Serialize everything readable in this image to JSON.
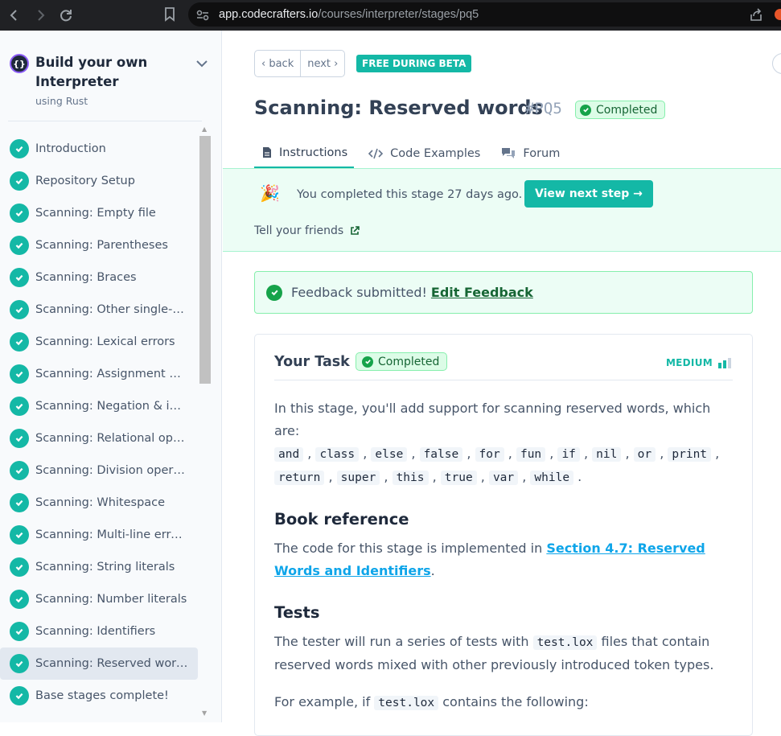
{
  "browser": {
    "url_host": "app.codecrafters.io",
    "url_path": "/courses/interpreter/stages/pq5"
  },
  "sidebar": {
    "course_title": "Build your own Interpreter",
    "course_subtitle": "using Rust",
    "stages": [
      {
        "label": "Introduction"
      },
      {
        "label": "Repository Setup"
      },
      {
        "label": "Scanning: Empty file"
      },
      {
        "label": "Scanning: Parentheses"
      },
      {
        "label": "Scanning: Braces"
      },
      {
        "label": "Scanning: Other single-c..."
      },
      {
        "label": "Scanning: Lexical errors"
      },
      {
        "label": "Scanning: Assignment & ..."
      },
      {
        "label": "Scanning: Negation & ine..."
      },
      {
        "label": "Scanning: Relational oper..."
      },
      {
        "label": "Scanning: Division operat..."
      },
      {
        "label": "Scanning: Whitespace"
      },
      {
        "label": "Scanning: Multi-line errors"
      },
      {
        "label": "Scanning: String literals"
      },
      {
        "label": "Scanning: Number literals"
      },
      {
        "label": "Scanning: Identifiers"
      },
      {
        "label": "Scanning: Reserved words"
      },
      {
        "label": "Base stages complete!"
      }
    ],
    "active_stage": "Scanning: Reserved words"
  },
  "header": {
    "back_label": "‹ back",
    "next_label": "next ›",
    "beta_badge": "FREE DURING BETA",
    "stage_title": "Scanning: Reserved words",
    "stage_slug": "#PQ5",
    "status": "Completed"
  },
  "tabs": [
    {
      "label": "Instructions",
      "active": true
    },
    {
      "label": "Code Examples",
      "active": false
    },
    {
      "label": "Forum",
      "active": false
    }
  ],
  "banner": {
    "message": "You completed this stage 27 days ago.",
    "button_label": "View next step →",
    "tell_friends": "Tell your friends"
  },
  "feedback": {
    "text": "Feedback submitted!",
    "link": "Edit Feedback"
  },
  "task": {
    "title": "Your Task",
    "status": "Completed",
    "difficulty": "MEDIUM",
    "intro": "In this stage, you'll add support for scanning reserved words, which are:",
    "reserved_words": [
      "and",
      "class",
      "else",
      "false",
      "for",
      "fun",
      "if",
      "nil",
      "or",
      "print",
      "return",
      "super",
      "this",
      "true",
      "var",
      "while"
    ],
    "book_heading": "Book reference",
    "book_text": "The code for this stage is implemented in ",
    "book_link": "Section 4.7: Reserved Words and Identifiers",
    "tests_heading": "Tests",
    "tests_text_1": "The tester will run a series of tests with ",
    "tests_code": "test.lox",
    "tests_text_2": " files that contain reserved words mixed with other previously introduced token types.",
    "example_text_1": "For example, if ",
    "example_code": "test.lox",
    "example_text_2": " contains the following:"
  },
  "colors": {
    "accent": "#14b8a6",
    "success_bg": "#ecfdf5",
    "success_text": "#166534",
    "link": "#0ea5e9"
  }
}
